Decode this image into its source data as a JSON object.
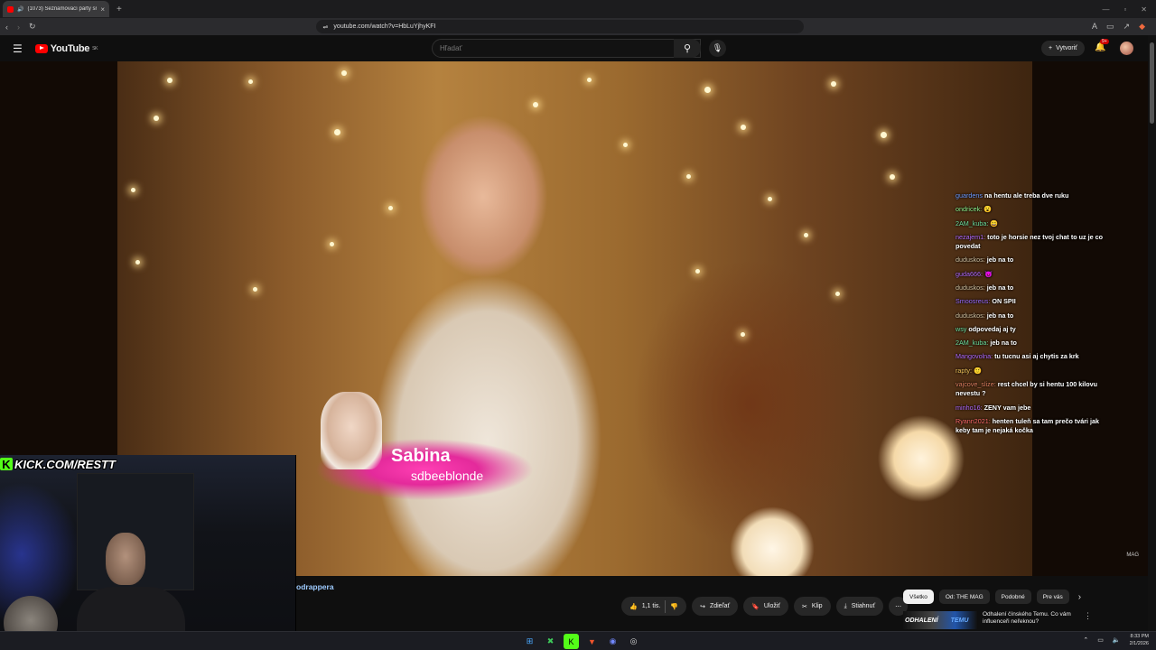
{
  "browser": {
    "tab_title": "(1073) Seznamovací party sr...",
    "url": "youtube.com/watch?v=HbLuYjhyKFI"
  },
  "youtube": {
    "logo_text": "YouTube",
    "region": "SK",
    "search_placeholder": "Hľadať",
    "create_label": "Vytvoriť",
    "notif_count": "9+"
  },
  "video": {
    "lower_third_name": "Sabina",
    "lower_third_handle": "sdbeeblonde",
    "watermark": "MAG"
  },
  "overlay": {
    "kick_url": "KICK.COM/RESTT",
    "kick_logo": "K"
  },
  "chat": [
    {
      "user": "guardens",
      "user_color": "#6f9bff",
      "text": "na hentu ale treba dve ruku"
    },
    {
      "user": "ondricek:",
      "user_color": "#8ef58e",
      "text": "😮"
    },
    {
      "user": "2AM_kuba:",
      "user_color": "#6ee0a0",
      "text": "😄"
    },
    {
      "user": "nezajem1:",
      "user_color": "#b26bff",
      "text": "toto je horsie nez tvoj chat to uz je co povedat"
    },
    {
      "user": "duduskos:",
      "user_color": "#d0c0a0",
      "text": "jeb na to"
    },
    {
      "user": "guda666:",
      "user_color": "#b26bff",
      "text": "😈"
    },
    {
      "user": "duduskos:",
      "user_color": "#d0c0a0",
      "text": "jeb na to"
    },
    {
      "user": "Smoosreus:",
      "user_color": "#9a6cff",
      "text": "ON SPII"
    },
    {
      "user": "duduskos:",
      "user_color": "#d0c0a0",
      "text": "jeb na to"
    },
    {
      "user": "wsy",
      "user_color": "#6ee0a0",
      "text": "odpovedaj aj ty"
    },
    {
      "user": "2AM_kuba:",
      "user_color": "#6ee0a0",
      "text": "jeb na to"
    },
    {
      "user": "Mangovolna:",
      "user_color": "#b26bff",
      "text": "tu tucnu asi aj chytis za krk"
    },
    {
      "user": "rapty:",
      "user_color": "#f2c45a",
      "text": "🙂"
    },
    {
      "user": "vajcove_slize:",
      "user_color": "#e08060",
      "text": "rest chcel by si hentu 100 kilovu nevestu ?"
    },
    {
      "user": "minho16:",
      "user_color": "#b26bff",
      "text": "ZENY vam jebe"
    },
    {
      "user": "Ryann2021:",
      "user_color": "#ff6a6a",
      "text": "henten tuleň sa tam prečo tvári jak keby tam je nejaká kočka"
    }
  ],
  "below": {
    "channel": "odrappera",
    "likes": "1,1 tis.",
    "share": "Zdieľať",
    "save": "Uložiť",
    "clip": "Klip",
    "download": "Stiahnuť"
  },
  "chips": [
    "Všetko",
    "Od: THE MAG",
    "Podobné",
    "Pre vás"
  ],
  "recommendation": {
    "thumb_text": "ODHALENÍ",
    "thumb_text2": "TEMU",
    "title": "Odhalení čínského Temu. Co vám influenceři neřeknou?"
  },
  "taskbar": {
    "time": "8:33 PM",
    "date": "2/1/2026"
  }
}
